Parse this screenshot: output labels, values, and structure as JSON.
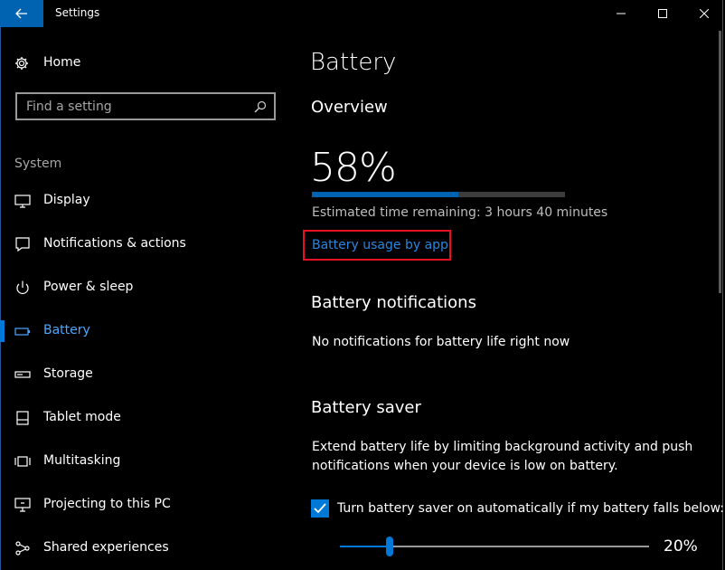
{
  "window": {
    "title": "Settings"
  },
  "sidebar": {
    "home_label": "Home",
    "search_placeholder": "Find a setting",
    "group_label": "System",
    "items": [
      {
        "label": "Display",
        "icon": "monitor-icon"
      },
      {
        "label": "Notifications & actions",
        "icon": "notifications-icon"
      },
      {
        "label": "Power & sleep",
        "icon": "power-icon"
      },
      {
        "label": "Battery",
        "icon": "battery-icon",
        "active": true
      },
      {
        "label": "Storage",
        "icon": "storage-icon"
      },
      {
        "label": "Tablet mode",
        "icon": "tablet-mode-icon"
      },
      {
        "label": "Multitasking",
        "icon": "multitasking-icon"
      },
      {
        "label": "Projecting to this PC",
        "icon": "projecting-icon"
      },
      {
        "label": "Shared experiences",
        "icon": "shared-experiences-icon"
      }
    ]
  },
  "main": {
    "title": "Battery",
    "overview": {
      "heading": "Overview",
      "percent": "58%",
      "level": 0.58,
      "estimate": "Estimated time remaining: 3 hours 40 minutes",
      "usage_link": "Battery usage by app"
    },
    "notifications": {
      "heading": "Battery notifications",
      "text": "No notifications for battery life right now"
    },
    "saver": {
      "heading": "Battery saver",
      "description_line1": "Extend battery life by limiting background activity and push",
      "description_line2": "notifications when your device is low on battery.",
      "auto_checkbox_label": "Turn battery saver on automatically if my battery falls below:",
      "auto_checked": true,
      "threshold": 20,
      "threshold_label": "20%"
    }
  },
  "colors": {
    "accent": "#0078d7",
    "link": "#2a86e0",
    "highlight_box": "#e81123"
  }
}
